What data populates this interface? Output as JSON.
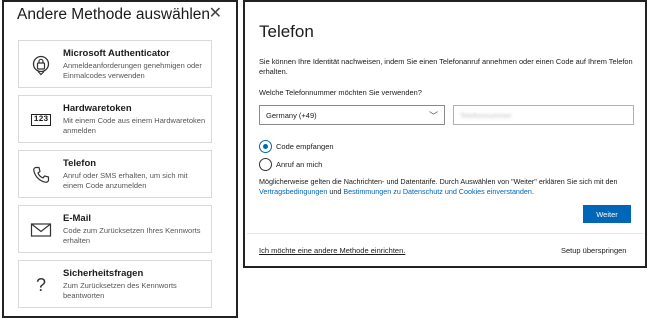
{
  "left_dialog": {
    "title": "Andere Methode auswählen",
    "close_glyph": "✕",
    "methods": [
      {
        "icon": "authenticator-lock-icon",
        "title": "Microsoft Authenticator",
        "desc": "Anmeldeanforderungen genehmigen oder Einmalcodes verwenden"
      },
      {
        "icon": "hardware-token-icon",
        "badge": "123",
        "title": "Hardwaretoken",
        "desc": "Mit einem Code aus einem Hardwaretoken anmelden"
      },
      {
        "icon": "phone-icon",
        "title": "Telefon",
        "desc": "Anruf oder SMS erhalten, um sich mit einem Code anzumelden"
      },
      {
        "icon": "mail-icon",
        "title": "E-Mail",
        "desc": "Code zum Zurücksetzen Ihres Kennworts erhalten"
      },
      {
        "icon": "question-icon",
        "glyph": "?",
        "title": "Sicherheitsfragen",
        "desc": "Zum Zurücksetzen des Kennworts beantworten"
      }
    ]
  },
  "right_dialog": {
    "title": "Telefon",
    "intro": "Sie können Ihre Identität nachweisen, indem Sie einen Telefonanruf annehmen oder einen Code auf Ihrem Telefon erhalten.",
    "question": "Welche Telefonnummer möchten Sie verwenden?",
    "country_select": {
      "value": "Germany (+49)",
      "chevron": "﹀"
    },
    "phone_input": {
      "placeholder": "Telefonnummer"
    },
    "options": [
      {
        "label": "Code empfangen",
        "checked": true
      },
      {
        "label": "Anruf an mich",
        "checked": false
      }
    ],
    "disclaimer": {
      "text_1": "Möglicherweise gelten die Nachrichten- und Datentarife. Durch Auswählen von \"Weiter\" erklären Sie sich mit den ",
      "link_1": "Vertragsbedingungen",
      "text_2": " und ",
      "link_2": "Bestimmungen zu Datenschutz und Cookies einverstanden",
      "text_3": "."
    },
    "next_button": "Weiter",
    "other_method_link": "Ich möchte eine andere Methode einrichten.",
    "skip_link": "Setup überspringen"
  },
  "colors": {
    "accent": "#0067b8",
    "border_dark": "#222222",
    "card_border": "#d9d9d9"
  }
}
